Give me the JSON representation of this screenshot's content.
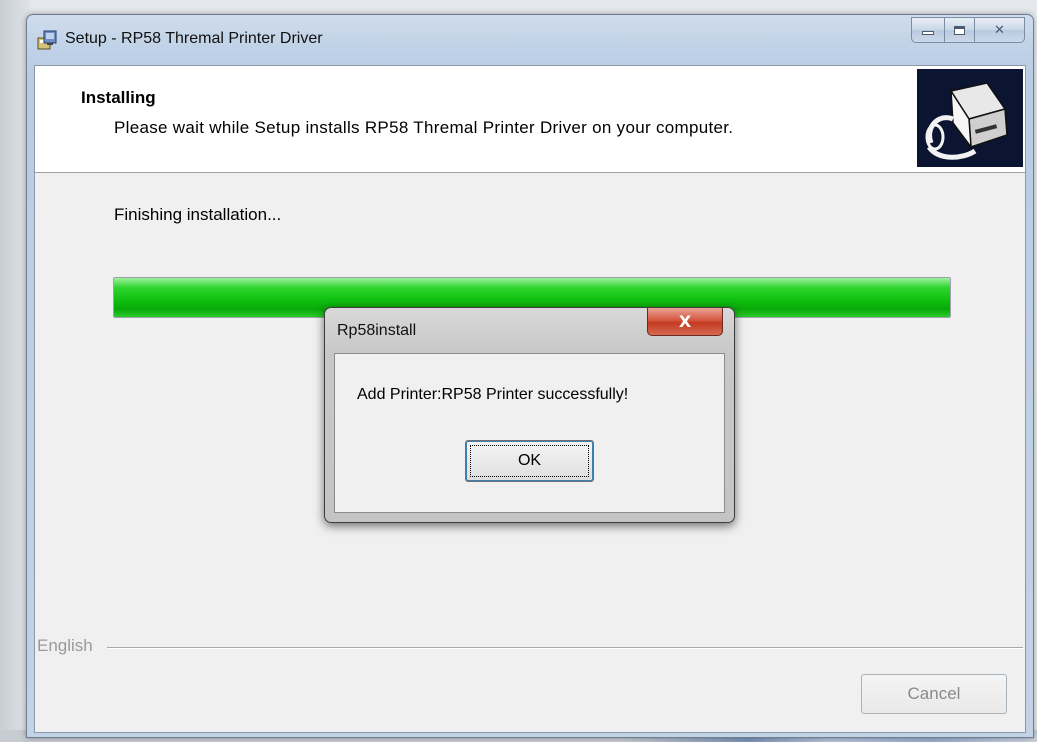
{
  "window": {
    "title": "Setup - RP58 Thremal Printer Driver",
    "controls": {
      "minimize": "minimize-button",
      "maximize": "maximize-button",
      "close": "✕"
    }
  },
  "header": {
    "title": "Installing",
    "subtitle": "Please wait while Setup installs RP58 Thremal Printer Driver on your computer.",
    "image_icon": "printer-setup-icon"
  },
  "main": {
    "status": "Finishing installation...",
    "progress": 1.0,
    "progress_color": "#12c212"
  },
  "footer": {
    "language_label": "English",
    "cancel_label": "Cancel"
  },
  "dialog": {
    "title": "Rp58install",
    "close_glyph": "X",
    "message": "Add Printer:RP58 Printer successfully!",
    "ok_label": "OK"
  },
  "colors": {
    "close_button": "#c8412a",
    "header_image_bg": "#0b1430",
    "progress": "#12c212"
  }
}
